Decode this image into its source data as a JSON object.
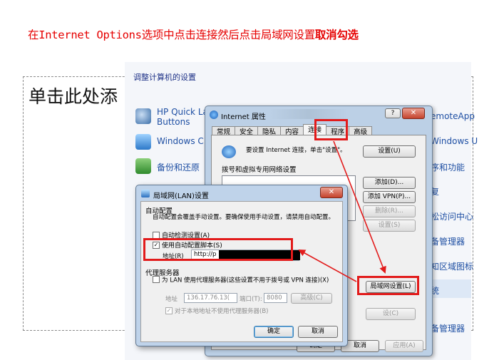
{
  "slide": {
    "instruction": "在Internet Options选项中点击连接然后点击局域网设置",
    "instruction_bold": "取消勾选",
    "placeholder": "单击此处添"
  },
  "control_panel": {
    "title": "调整计算机的设置",
    "left_items": [
      {
        "label": "HP Quick La",
        "label2": "Buttons",
        "icon": "hp-quick-launch-icon"
      },
      {
        "label": "Windows C",
        "icon": "windows-cardspace-icon"
      },
      {
        "label": "备份和还原",
        "icon": "backup-restore-icon"
      }
    ],
    "right_items": [
      "emoteApp",
      "Windows U",
      "序和功能",
      "复",
      "松访问中心",
      "备管理器",
      "知区域图标",
      "统",
      "备管理器"
    ]
  },
  "internet_options": {
    "title": "Internet 属性",
    "help": "?",
    "close": "✕",
    "tabs": [
      "常规",
      "安全",
      "隐私",
      "内容",
      "连接",
      "程序",
      "高级"
    ],
    "setup_text": "要设置 Internet 连接，单击\"设置\"。",
    "setup_button": "设置(U)",
    "dialup_label": "拨号和虚拟专用网络设置",
    "add_button": "添加(D)...",
    "add_vpn_button": "添加 VPN(P)...",
    "remove_button": "删除(R)...",
    "settings_button": "设置(S)",
    "lan_button": "局域网设置(L)",
    "settings2_button": "设(C)",
    "ok_button": "确定",
    "cancel_button": "取消",
    "apply_button": "应用(A)"
  },
  "lan": {
    "title": "局域网(LAN)设置",
    "close": "✕",
    "auto_config_header": "自动配置",
    "auto_config_desc": "自动配置会覆盖手动设置。要确保使用手动设置，请禁用自动配置。",
    "auto_detect": "自动检测设置(A)",
    "use_script": "使用自动配置脚本(S)",
    "use_script_checked": "✓",
    "address_label": "地址(R)",
    "address_value": "http://p",
    "proxy_header": "代理服务器",
    "proxy_desc": "为 LAN 使用代理服务器(这些设置不用于拨号或 VPN 连接)(X)",
    "proxy_address_label": "地址",
    "proxy_address_value": "136.17.76.13(",
    "port_label": "端口(T):",
    "port_value": "8080",
    "advanced_button": "高级(C)",
    "bypass_local": "对于本地地址不使用代理服务器(B)",
    "bypass_checked": "✓",
    "ok_button": "确定",
    "cancel_button": "取消"
  },
  "colors": {
    "highlight": "#e21b1b",
    "title_text": "#e60000",
    "link": "#1e4fa3"
  }
}
